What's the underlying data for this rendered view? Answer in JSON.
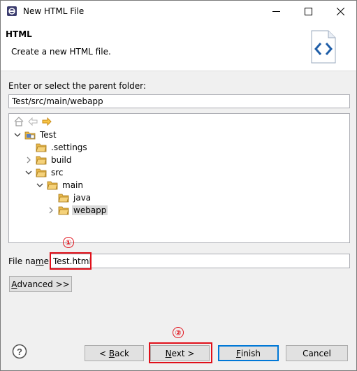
{
  "window": {
    "title": "New HTML File"
  },
  "header": {
    "title": "HTML",
    "description": "Create a new HTML file."
  },
  "parent_folder": {
    "label": "Enter or select the parent folder:",
    "value": "Test/src/main/webapp"
  },
  "tree": {
    "nodes": [
      {
        "label": "Test",
        "expanded": true
      },
      {
        "label": ".settings"
      },
      {
        "label": "build",
        "expanded": false
      },
      {
        "label": "src",
        "expanded": true
      },
      {
        "label": "main",
        "expanded": true
      },
      {
        "label": "java"
      },
      {
        "label": "webapp",
        "selected": true
      }
    ]
  },
  "file_name": {
    "label_pre": "File na",
    "label_mnemonic": "m",
    "label_post": "e:",
    "value": "Test.html"
  },
  "advanced": {
    "mnemonic": "A",
    "rest": "dvanced >>"
  },
  "markers": {
    "first": "①",
    "second": "②"
  },
  "buttons": {
    "back": {
      "pre": "< ",
      "mnemonic": "B",
      "post": "ack"
    },
    "next": {
      "pre": "",
      "mnemonic": "N",
      "post": "ext >"
    },
    "finish": {
      "pre": "",
      "mnemonic": "F",
      "post": "inish"
    },
    "cancel": "Cancel"
  },
  "colors": {
    "highlight": "#e0101a",
    "accent": "#0078d7",
    "folder": "#e8b84a"
  }
}
